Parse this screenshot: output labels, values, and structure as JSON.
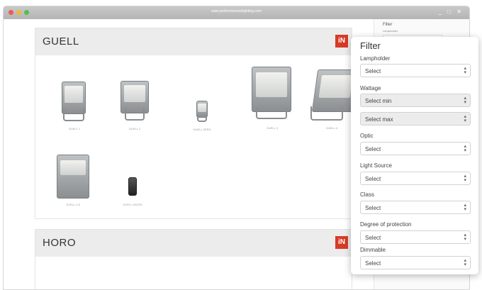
{
  "window": {
    "url": "www.performanceinlighting.com",
    "controls": "_ □ ✕",
    "traffic_colors": [
      "#ee5b55",
      "#f1b83b",
      "#53c04a"
    ]
  },
  "sections": [
    {
      "title": "GUELL",
      "logo": "iN",
      "products": [
        "GUELL 1",
        "GUELL 2",
        "GUELL ZERO",
        "GUELL 3",
        "GUELL 4",
        "GUELL 2.5",
        "GUELL MICRO"
      ]
    },
    {
      "title": "HORO",
      "logo": "iN"
    }
  ],
  "sidebar": {
    "title": "Filter",
    "first_label": "Lampholder"
  },
  "filter": {
    "title": "Filter",
    "fields": [
      {
        "label": "Lampholder",
        "selects": [
          "Select"
        ]
      },
      {
        "label": "Wattage",
        "selects": [
          "Select min",
          "Select max"
        ]
      },
      {
        "label": "Optic",
        "selects": [
          "Select"
        ]
      },
      {
        "label": "Light Source",
        "selects": [
          "Select"
        ]
      },
      {
        "label": "Class",
        "selects": [
          "Select"
        ]
      },
      {
        "label": "Degree of protection",
        "selects": [
          "Select"
        ]
      },
      {
        "label": "Dimmable",
        "selects": [
          "Select"
        ]
      }
    ],
    "arrow": "⇕",
    "accent": "#d73a27"
  }
}
